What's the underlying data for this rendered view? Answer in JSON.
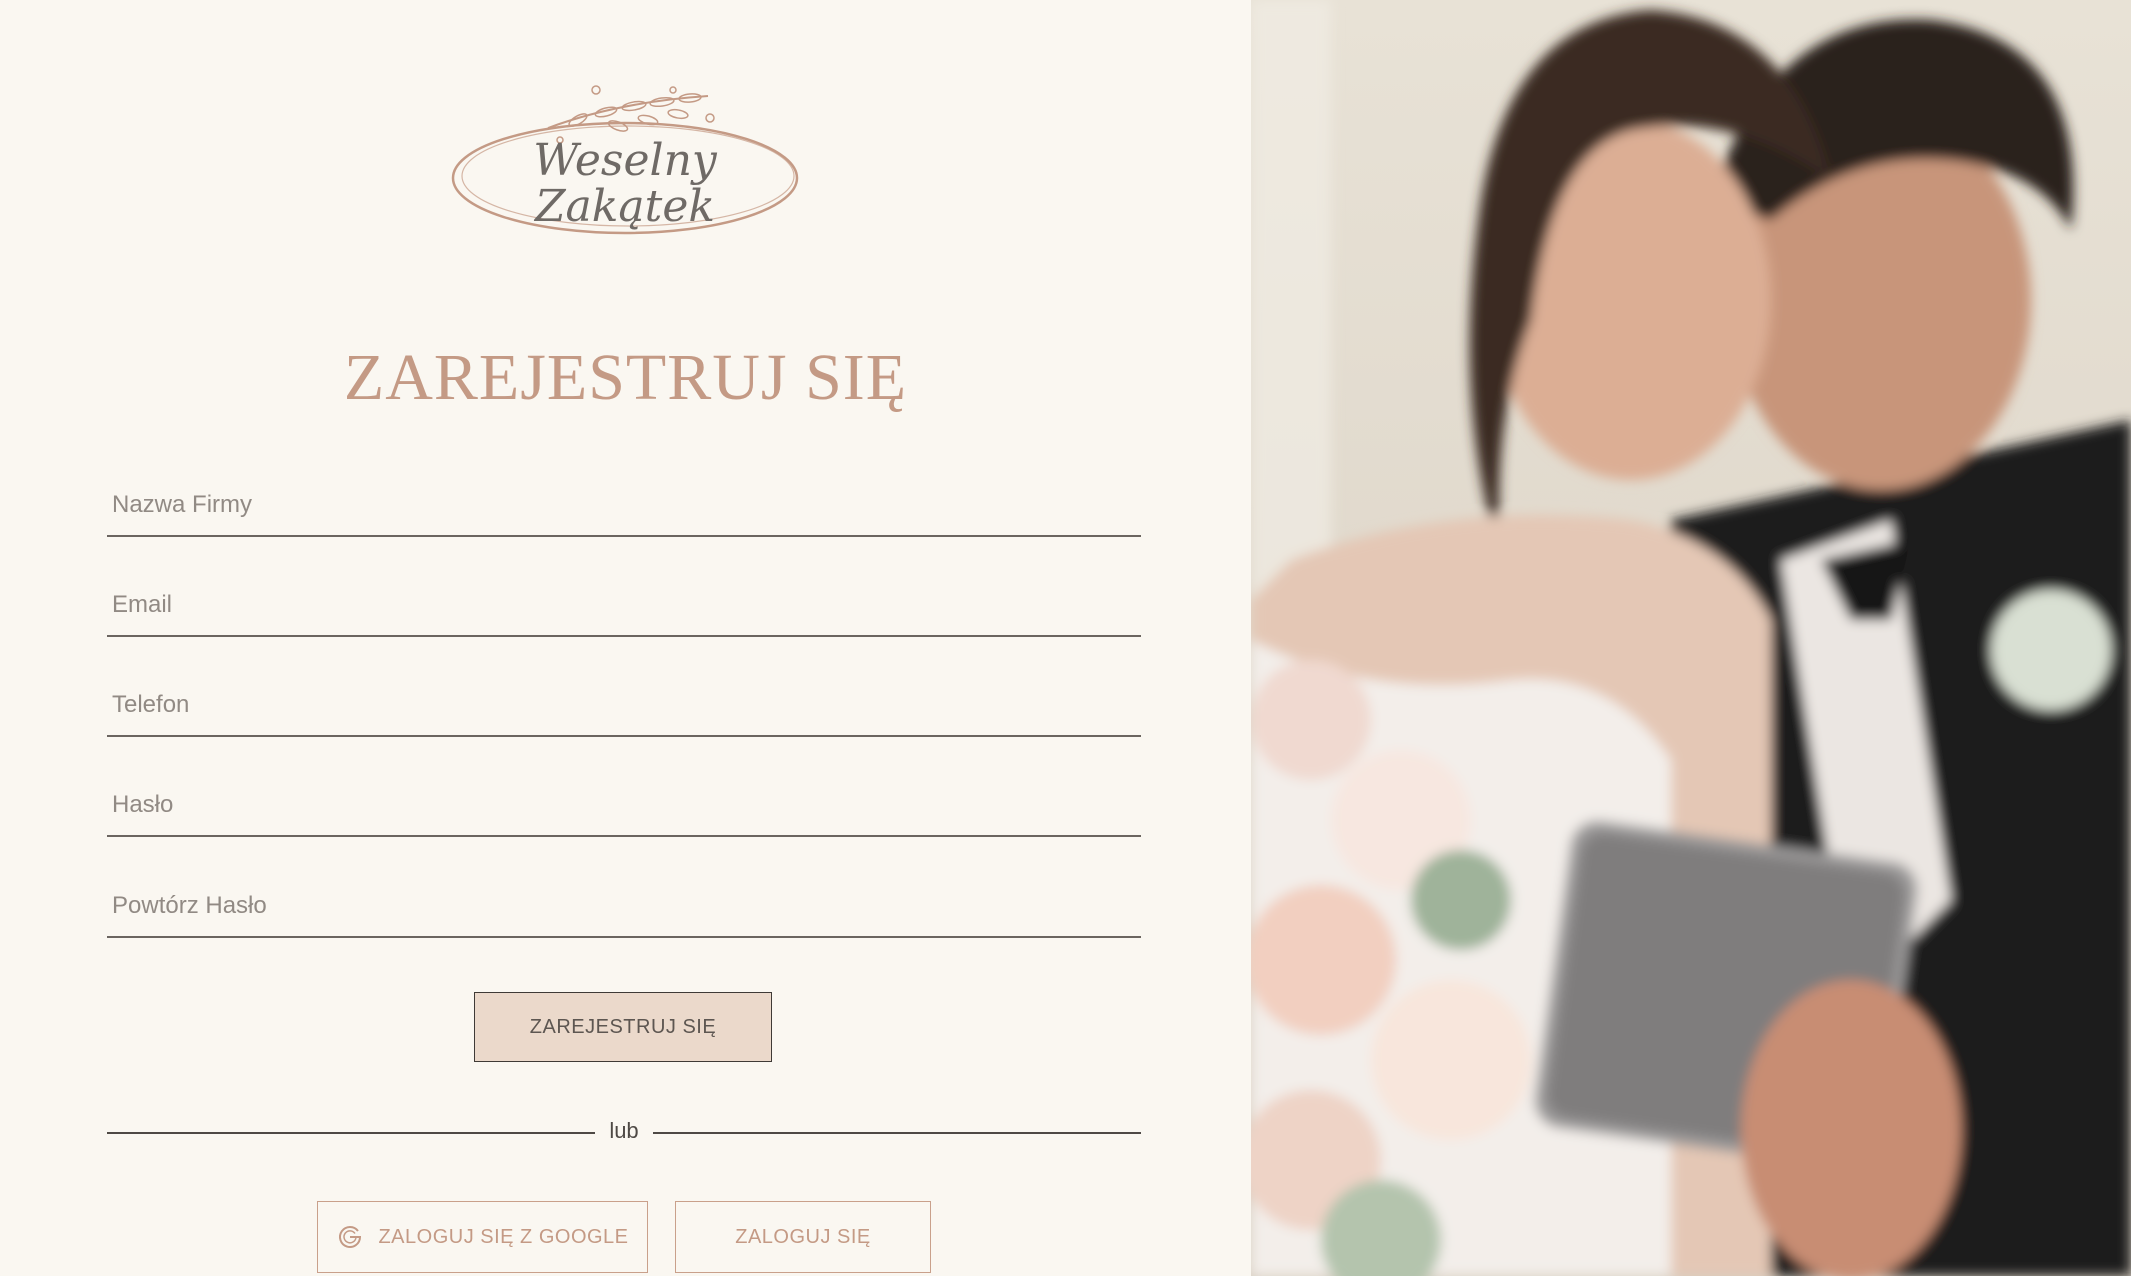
{
  "logo": {
    "line1": "Weselny",
    "line2": "Zakątek"
  },
  "heading": "ZAREJESTRUJ SIĘ",
  "form": {
    "fields": [
      {
        "placeholder": "Nazwa Firmy",
        "value": ""
      },
      {
        "placeholder": "Email",
        "value": ""
      },
      {
        "placeholder": "Telefon",
        "value": ""
      },
      {
        "placeholder": "Hasło",
        "value": ""
      },
      {
        "placeholder": "Powtórz Hasło",
        "value": ""
      }
    ],
    "submit_label": "ZAREJESTRUJ SIĘ"
  },
  "divider": {
    "text": "lub"
  },
  "alt_actions": {
    "google_label": "ZALOGUJ SIĘ Z GOOGLE",
    "google_icon": "google-icon",
    "login_label": "ZALOGUJ SIĘ"
  },
  "colors": {
    "background": "#faf7f1",
    "accent": "#c49a85",
    "button_fill": "#ebd9cb",
    "text_dark": "#4e4945"
  }
}
